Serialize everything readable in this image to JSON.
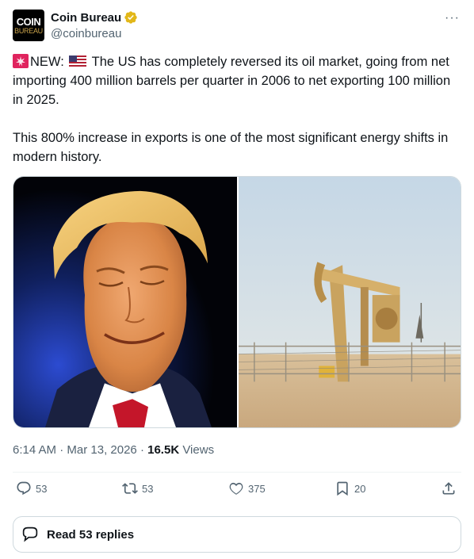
{
  "author": {
    "display_name": "Coin Bureau",
    "handle": "@coinbureau",
    "avatar_text_top": "COIN",
    "avatar_text_bottom": "BUREAU",
    "verified_color": "#e2b719"
  },
  "tweet": {
    "prefix": "NEW:",
    "line1_after_flag": "The US has completely reversed its oil market, going from net importing 400 million barrels per quarter in 2006 to net exporting 100 million in 2025.",
    "paragraph2": "This 800% increase in exports is one of the most significant energy shifts in modern history."
  },
  "media": {
    "left_image": "smiling-man-photo",
    "right_image": "oil-pumpjack-photo"
  },
  "meta": {
    "time": "6:14 AM",
    "separator": "·",
    "date": "Mar 13, 2026",
    "views_count": "16.5K",
    "views_label": "Views"
  },
  "actions": {
    "replies": "53",
    "reposts": "53",
    "likes": "375",
    "bookmarks": "20"
  },
  "read_replies_label": "Read 53 replies",
  "colors": {
    "text": "#0f1419",
    "secondary": "#536471",
    "border": "#cfd9de"
  }
}
